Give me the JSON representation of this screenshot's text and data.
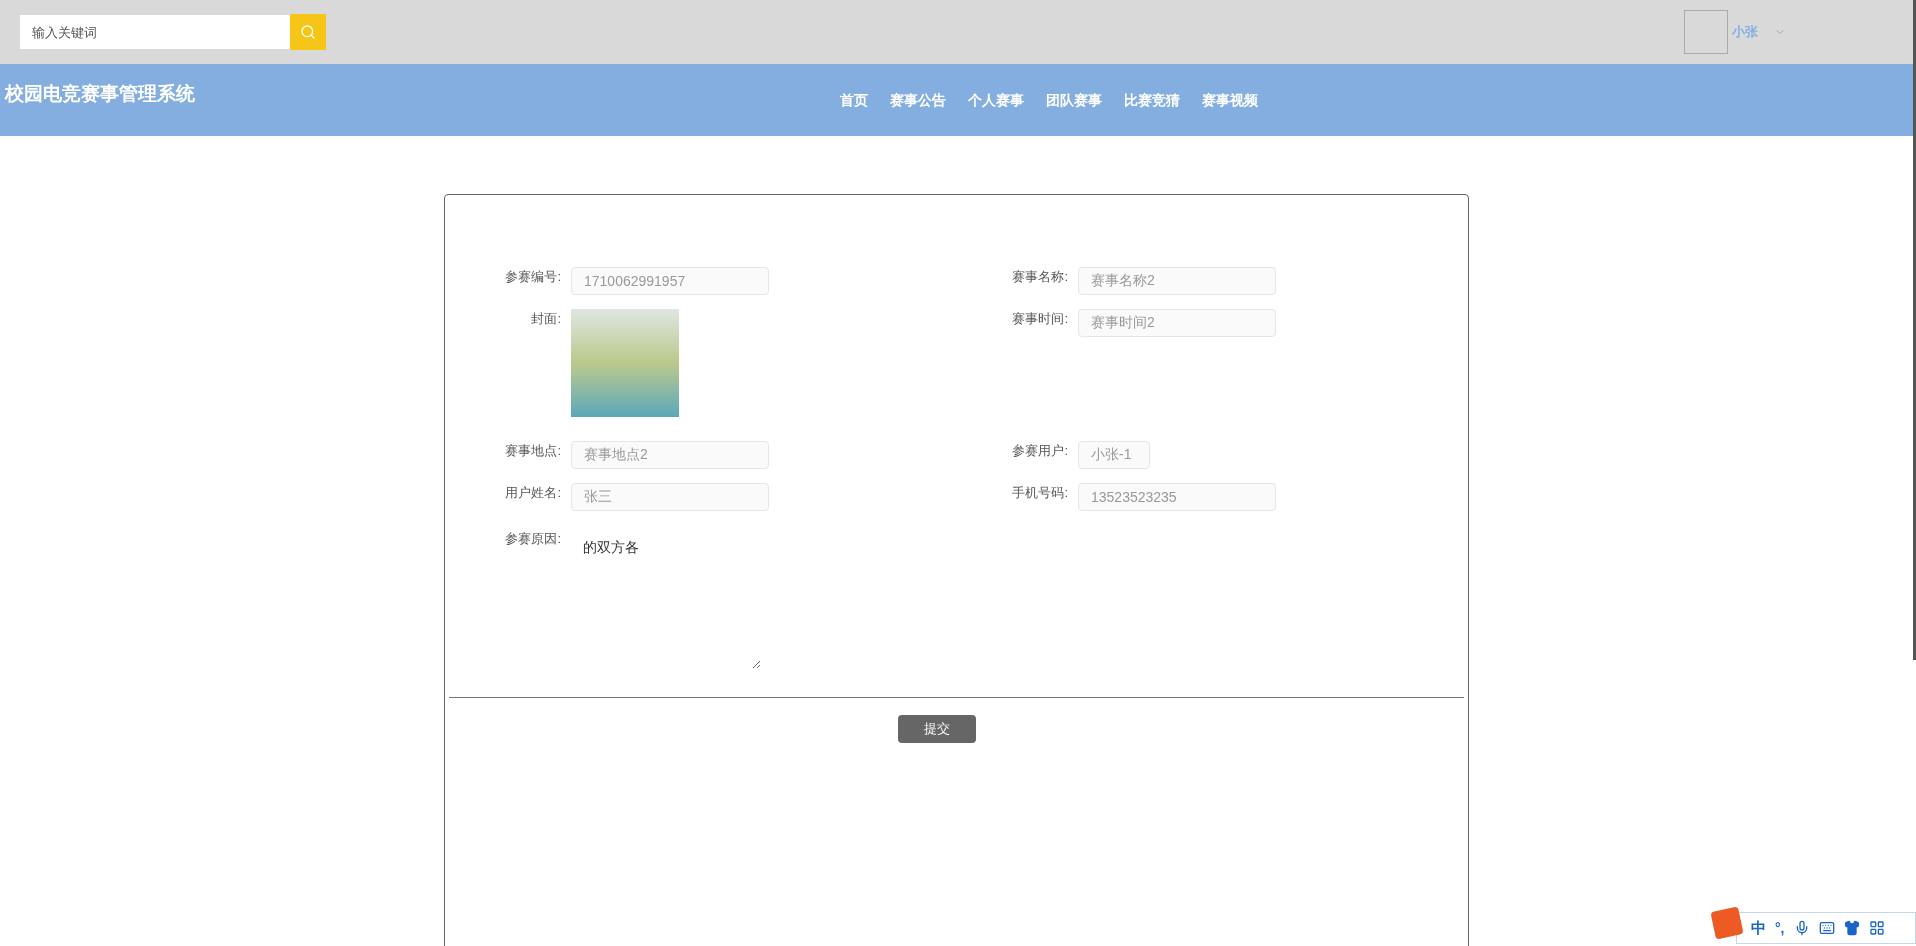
{
  "top_bar": {
    "search": {
      "placeholder": "输入关键词"
    },
    "user": {
      "name": "小张"
    }
  },
  "header": {
    "title": "校园电竞赛事管理系统",
    "nav": [
      {
        "label": "首页"
      },
      {
        "label": "赛事公告"
      },
      {
        "label": "个人赛事"
      },
      {
        "label": "团队赛事"
      },
      {
        "label": "比赛竞猜"
      },
      {
        "label": "赛事视频"
      }
    ]
  },
  "form": {
    "rows": [
      [
        {
          "kind": "input",
          "label": "参赛编号:",
          "value": "1710062991957"
        },
        {
          "kind": "input",
          "label": "赛事名称:",
          "value": "赛事名称2"
        }
      ],
      [
        {
          "kind": "image",
          "label": "封面:"
        },
        {
          "kind": "input",
          "label": "赛事时间:",
          "value": "赛事时间2"
        }
      ],
      [
        {
          "kind": "input",
          "label": "赛事地点:",
          "value": "赛事地点2"
        },
        {
          "kind": "short",
          "label": "参赛用户:",
          "value": "小张-1"
        }
      ],
      [
        {
          "kind": "input",
          "label": "用户姓名:",
          "value": "张三"
        },
        {
          "kind": "input",
          "label": "手机号码:",
          "value": "13523523235"
        }
      ]
    ],
    "reason": {
      "label": "参赛原因:",
      "value": "的双方各"
    },
    "submit": "提交"
  },
  "ime_toolbar": {
    "mode": "中",
    "punctuation": "°,"
  }
}
